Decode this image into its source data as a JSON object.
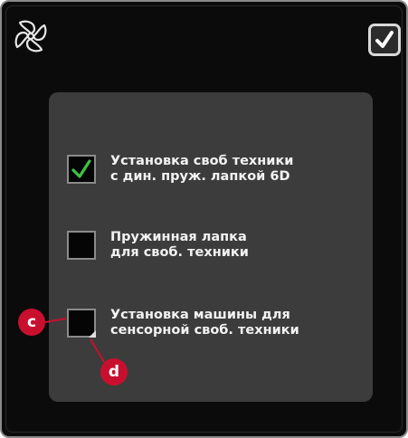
{
  "header": {
    "fan_icon": "fan-icon",
    "confirm_icon": "checkmark-icon"
  },
  "options": [
    {
      "line1": "Установка своб техники",
      "line2": "с дин. пруж. лапкой 6D",
      "checked": true
    },
    {
      "line1": "Пружинная лапка",
      "line2": "для своб. техники",
      "checked": false
    },
    {
      "line1": "Установка машины для",
      "line2": "сенсорной своб. техники",
      "checked": false
    }
  ],
  "callouts": {
    "c": "c",
    "d": "d"
  },
  "colors": {
    "check_green": "#3ec43e",
    "callout_red": "#c8102e",
    "panel": "#3c3c3c",
    "screen": "#0b0b0b"
  }
}
